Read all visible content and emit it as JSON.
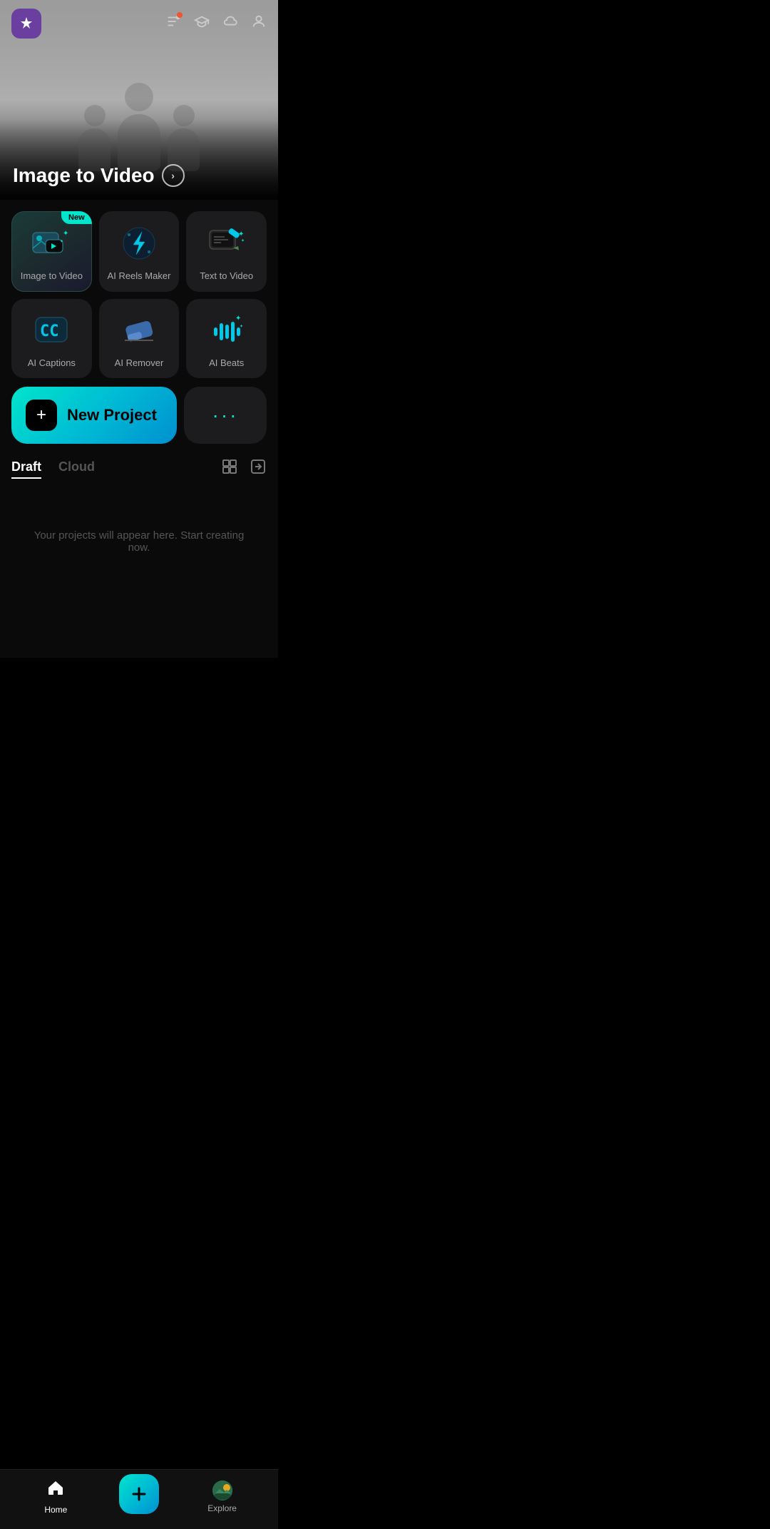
{
  "hero": {
    "title": "Image to Video",
    "arrow_label": "›"
  },
  "topbar": {
    "logo_emoji": "♟",
    "icons": [
      "filter-icon",
      "graduation-icon",
      "cloud-icon",
      "face-icon"
    ]
  },
  "tools": [
    {
      "id": "image-to-video",
      "label": "Image to Video",
      "badge": "New",
      "featured": true
    },
    {
      "id": "ai-reels-maker",
      "label": "AI Reels Maker",
      "badge": null,
      "featured": false
    },
    {
      "id": "text-to-video",
      "label": "Text to Video",
      "badge": null,
      "featured": false
    },
    {
      "id": "ai-captions",
      "label": "AI Captions",
      "badge": null,
      "featured": false
    },
    {
      "id": "ai-remover",
      "label": "AI Remover",
      "badge": null,
      "featured": false
    },
    {
      "id": "ai-beats",
      "label": "AI Beats",
      "badge": null,
      "featured": false
    }
  ],
  "new_project": {
    "label": "New Project",
    "plus_icon": "+"
  },
  "more_btn_dots": "···",
  "tabs": {
    "draft": "Draft",
    "cloud": "Cloud",
    "active": "draft"
  },
  "empty_state": {
    "text": "Your projects will appear here. Start creating now."
  },
  "bottom_nav": {
    "home": "Home",
    "create_icon": "+",
    "explore": "Explore"
  }
}
